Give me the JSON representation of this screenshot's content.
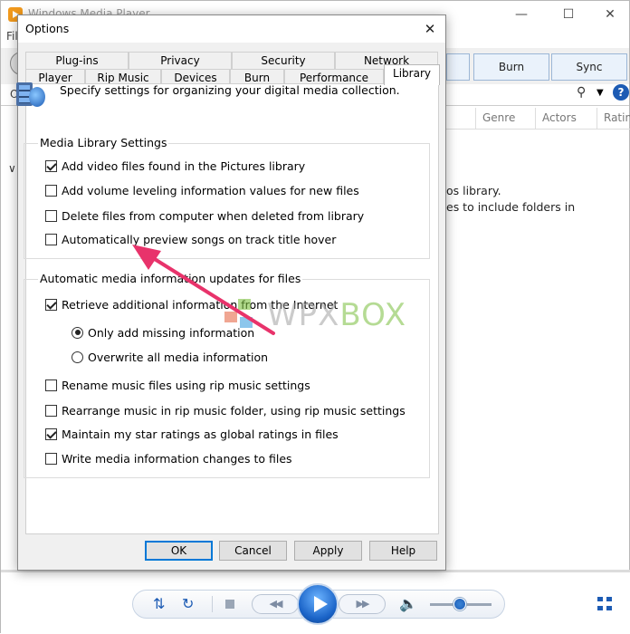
{
  "background": {
    "title": "Windows Media Player",
    "menu_letter": "Fil",
    "tabs": [
      "Burn",
      "Sync"
    ],
    "addr_letter": "O",
    "columns": [
      "Genre",
      "Actors",
      "Ratin"
    ],
    "message_lines": [
      "os library.",
      "es to include folders in"
    ]
  },
  "dialog": {
    "title": "Options",
    "tabs_row1": [
      "Plug-ins",
      "Privacy",
      "Security",
      "Network"
    ],
    "tabs_row2": [
      "Player",
      "Rip Music",
      "Devices",
      "Burn",
      "Performance",
      "Library"
    ],
    "active_tab": "Library",
    "description": "Specify settings for organizing your digital media collection.",
    "media_library": {
      "label": "Media Library Settings",
      "items": [
        {
          "label": "Add video files found in the Pictures library",
          "checked": true
        },
        {
          "label": "Add volume leveling information values for new files",
          "checked": false
        },
        {
          "label": "Delete files from computer when deleted from library",
          "checked": false
        },
        {
          "label": "Automatically preview songs on track title hover",
          "checked": false
        }
      ]
    },
    "auto_updates": {
      "label": "Automatic media information updates for files",
      "retrieve": {
        "label": "Retrieve additional information from the Internet",
        "checked": true
      },
      "radios": [
        {
          "label": "Only add missing information",
          "checked": true
        },
        {
          "label": "Overwrite all media information",
          "checked": false
        }
      ],
      "items": [
        {
          "label": "Rename music files using rip music settings",
          "checked": false
        },
        {
          "label": "Rearrange music in rip music folder, using rip music settings",
          "checked": false
        },
        {
          "label": "Maintain my star ratings as global ratings in files",
          "checked": true
        },
        {
          "label": "Write media information changes to files",
          "checked": false
        }
      ]
    },
    "buttons": {
      "ok": "OK",
      "cancel": "Cancel",
      "apply": "Apply",
      "help": "Help"
    }
  },
  "watermark": {
    "text_a": "WPX",
    "text_b": "BOX"
  },
  "colors": {
    "accent": "#1c5bb4",
    "arrow": "#e8336b",
    "focus": "#0078d7"
  }
}
